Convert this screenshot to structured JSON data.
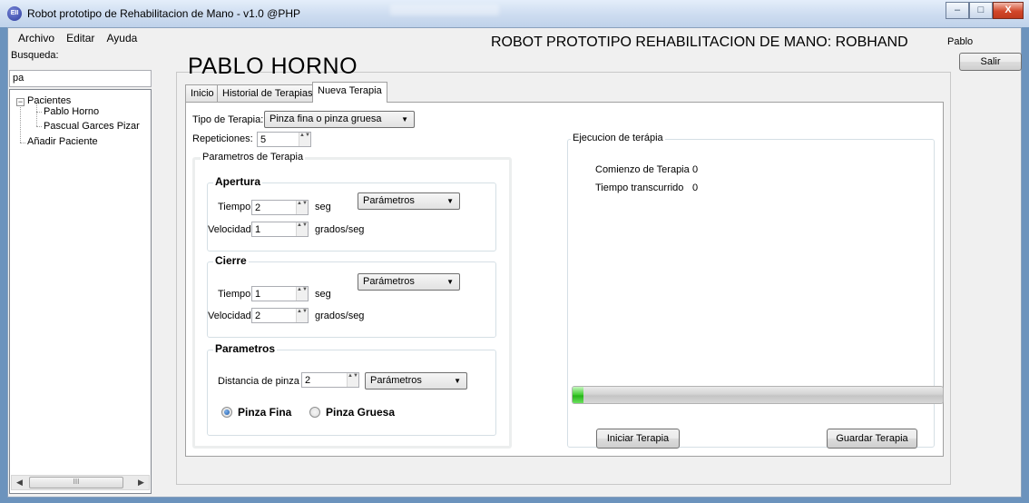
{
  "window": {
    "title": "Robot prototipo de Rehabilitacion de Mano - v1.0 @PHP",
    "minimize": "–",
    "maximize": "□",
    "close": "X"
  },
  "menu": {
    "items": [
      "Archivo",
      "Editar",
      "Ayuda"
    ]
  },
  "header": {
    "app_title": "ROBOT PROTOTIPO REHABILITACION DE MANO: ROBHAND",
    "user": "Pablo",
    "logout_label": "Salir"
  },
  "sidebar": {
    "search_label": "Busqueda:",
    "search_value": "pa",
    "tree": {
      "root_expander": "−",
      "root": "Pacientes",
      "patients": [
        "Pablo Horno",
        "Pascual  Garces Pizar"
      ],
      "add_patient": "Añadir Paciente"
    },
    "scroll_left": "◀",
    "scroll_right": "▶",
    "scroll_grip": "III"
  },
  "patient_name": "PABLO HORNO",
  "tabs": [
    "Inicio",
    "Historial de Terapias",
    "Nueva Terapia"
  ],
  "active_tab": "Nueva Terapia",
  "therapy": {
    "type_label": "Tipo de Terapia:",
    "type_value": "Pinza fina o pinza gruesa",
    "reps_label": "Repeticiones:",
    "reps_value": "5",
    "params_group": "Parametros de Terapia",
    "apertura": {
      "title": "Apertura",
      "time_label": "Tiempo",
      "time_value": "2",
      "time_unit": "seg",
      "speed_label": "Velocidad",
      "speed_value": "1",
      "speed_unit": "grados/seg",
      "preset": "Parámetros"
    },
    "cierre": {
      "title": "Cierre",
      "time_label": "Tiempo",
      "time_value": "1",
      "time_unit": "seg",
      "speed_label": "Velocidad",
      "speed_value": "2",
      "speed_unit": "grados/seg",
      "preset": "Parámetros"
    },
    "parametros": {
      "title": "Parametros",
      "distance_label": "Distancia de pinza",
      "distance_value": "2",
      "preset": "Parámetros",
      "option_fine": "Pinza Fina",
      "option_coarse": "Pinza Gruesa",
      "selected": "Pinza Fina"
    }
  },
  "execution": {
    "group_title": "Ejecucion de terápia",
    "start_label": "Comienzo de Terapia",
    "start_value": "0",
    "elapsed_label": "Tiempo transcurrido",
    "elapsed_value": "0",
    "progress": 0.03,
    "start_button": "Iniciar Terapia",
    "save_button": "Guardar Terapia"
  },
  "arrows": {
    "dropdown": "▼",
    "spin": "▲▼"
  }
}
